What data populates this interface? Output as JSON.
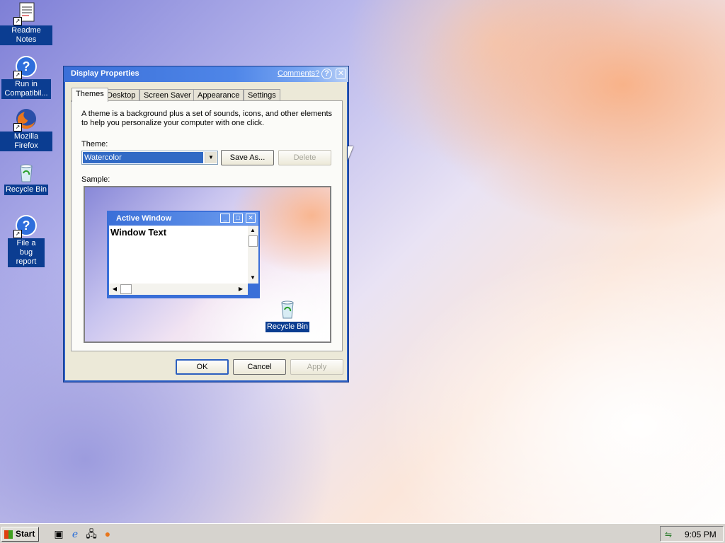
{
  "desktop": {
    "icons": [
      {
        "label": "Readme Notes",
        "icon": "document-icon"
      },
      {
        "label": "Run in Compatibil...",
        "icon": "help-icon"
      },
      {
        "label": "Mozilla Firefox",
        "icon": "firefox-icon"
      },
      {
        "label": "Recycle Bin",
        "icon": "recycle-bin-icon"
      },
      {
        "label": "File a bug report",
        "icon": "help-icon"
      }
    ]
  },
  "dialog": {
    "title": "Display Properties",
    "comments_link": "Comments?",
    "help_glyph": "?",
    "close_glyph": "✕",
    "tabs": [
      "Themes",
      "Desktop",
      "Screen Saver",
      "Appearance",
      "Settings"
    ],
    "active_tab": "Themes",
    "description": "A theme is a background plus a set of sounds, icons, and other elements to help you personalize your computer with one click.",
    "theme_label": "Theme:",
    "theme_value": "Watercolor",
    "save_as_label": "Save As...",
    "delete_label": "Delete",
    "sample_label": "Sample:",
    "sample": {
      "window_title": "Active Window",
      "window_text": "Window Text",
      "recycle_label": "Recycle Bin"
    },
    "ok_label": "OK",
    "cancel_label": "Cancel",
    "apply_label": "Apply"
  },
  "taskbar": {
    "start_label": "Start",
    "quick_launch": [
      "show-desktop-icon",
      "internet-explorer-icon",
      "network-icon",
      "firefox-icon"
    ],
    "clock": "9:05 PM"
  }
}
